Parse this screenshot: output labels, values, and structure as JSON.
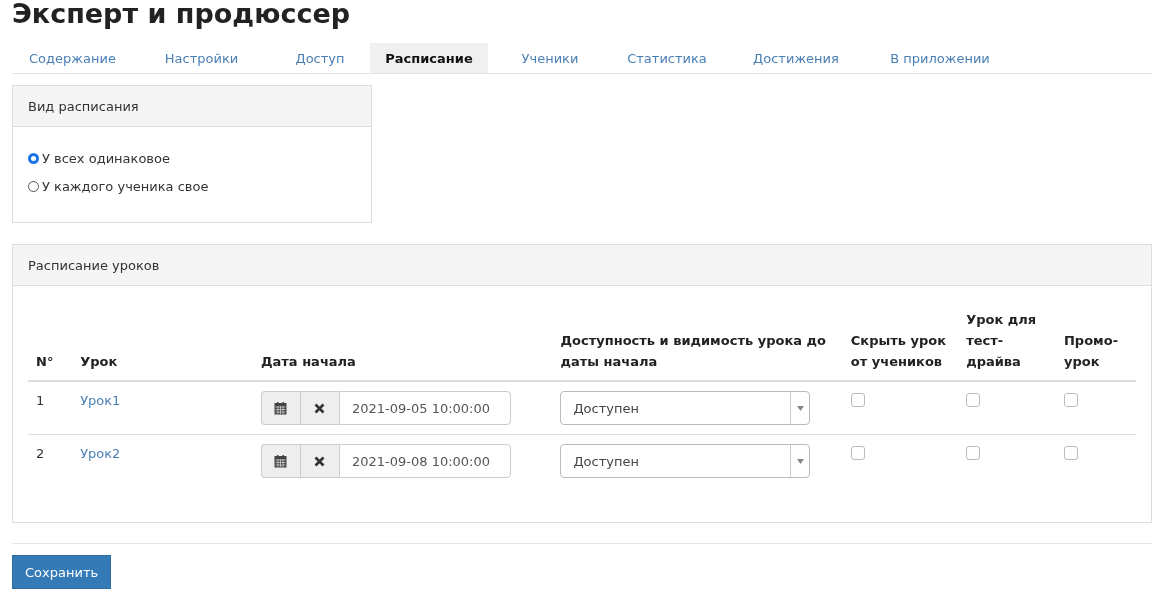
{
  "title": "Эксперт и продюссер",
  "tabs": [
    {
      "label": "Содержание",
      "selected": false
    },
    {
      "label": "Настройки",
      "selected": false
    },
    {
      "label": "Доступ",
      "selected": false
    },
    {
      "label": "Расписание",
      "selected": true
    },
    {
      "label": "Ученики",
      "selected": false
    },
    {
      "label": "Статистика",
      "selected": false
    },
    {
      "label": "Достижения",
      "selected": false
    },
    {
      "label": "В приложении",
      "selected": false
    }
  ],
  "schedule_type": {
    "title": "Вид расписания",
    "options": [
      {
        "label": "У всех одинаковое",
        "selected": true
      },
      {
        "label": "У каждого ученика свое",
        "selected": false
      }
    ]
  },
  "lessons": {
    "title": "Расписание уроков",
    "columns": [
      "N°",
      "Урок",
      "Дата начала",
      "Доступность и видимость урока до даты начала",
      "Скрыть урок от учеников",
      "Урок для тест-драйва",
      "Промо-урок"
    ],
    "rows": [
      {
        "number": "1",
        "lesson": "Урок1",
        "start_date": "2021-09-05 10:00:00",
        "availability": "Доступен",
        "hidden": false,
        "test_drive": false,
        "promo": false
      },
      {
        "number": "2",
        "lesson": "Урок2",
        "start_date": "2021-09-08 10:00:00",
        "availability": "Доступен",
        "hidden": false,
        "test_drive": false,
        "promo": false
      }
    ]
  },
  "save_button": "Сохранить"
}
